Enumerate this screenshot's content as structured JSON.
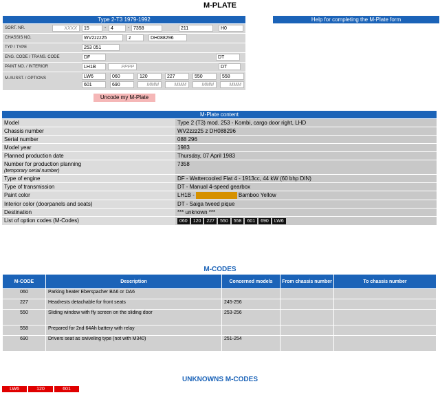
{
  "page_title": "M-PLATE",
  "form": {
    "header": "Type 2-T3 1979-1992",
    "help_header": "Help for completing the M-Plate form",
    "labels": {
      "sort_nr": "SORT. NR.",
      "chassis_no": "CHASSIS NO.",
      "typ": "TYP / TYPE",
      "eng_code": "ENG. CODE / TRANS. CODE",
      "paint_no": "PAINT NO. / INTERIOR",
      "m_ausst": "M-AUSST. / OPTIONS"
    },
    "sort_nr": {
      "placeholder": "XXXX",
      "f2": "15",
      "dash1": "-",
      "f3": "4",
      "dash2": "-",
      "f4": "7358",
      "f5": "211",
      "f6": "H0"
    },
    "chassis": {
      "f1": "WV2zzz25",
      "f2": "z",
      "f3": "DH088296"
    },
    "typ": {
      "f1": "253 051"
    },
    "eng": {
      "engine": "DF",
      "trans": "DT"
    },
    "paint": {
      "paint": "LH1B",
      "interior_placeholder": "PPPP",
      "interior": "DT"
    },
    "options_row1": [
      "LW6",
      "060",
      "120",
      "227",
      "550",
      "558"
    ],
    "options_row2": [
      "601",
      "690",
      "MMM",
      "MMM",
      "MMM",
      "MMM"
    ],
    "button": "Uncode my M-Plate"
  },
  "content": {
    "header": "M-Plate content",
    "rows": {
      "model": {
        "k": "Model",
        "v": "Type 2 (T3) mod. 253 - Kombi, cargo door right, LHD"
      },
      "chassis": {
        "k": "Chassis number",
        "v": "WV2zzz25 z DH088296"
      },
      "serial": {
        "k": "Serial number",
        "v": "088 296"
      },
      "year": {
        "k": "Model year",
        "v": "1983"
      },
      "date": {
        "k": "Planned production date",
        "v": "Thursday, 07 April 1983"
      },
      "prod": {
        "k": "Number for production planning",
        "sub": "(temporary serial number)",
        "v": "7358"
      },
      "engine": {
        "k": "Type of engine",
        "v": "DF - Wattercooled Flat 4 - 1913cc, 44 kW (60 bhp DIN)"
      },
      "trans": {
        "k": "Type of transmission",
        "v": "DT - Manual 4-speed gearbox"
      },
      "paint": {
        "k": "Paint color",
        "code": "LH1B -",
        "name": "Bamboo Yellow",
        "color": "#d69100"
      },
      "interior": {
        "k": "Interior color (doorpanels and seats)",
        "v": "DT - Saiga tweed pique"
      },
      "dest": {
        "k": "Destination",
        "v": "*** unknown ***"
      },
      "options": {
        "k": "List of option codes (M-Codes)",
        "codes": [
          "060",
          "120",
          "227",
          "550",
          "558",
          "601",
          "690",
          "LW6"
        ]
      }
    }
  },
  "mcodes": {
    "title": "M-CODES",
    "headers": [
      "M-CODE",
      "Description",
      "Concerned models",
      "From chassis number",
      "To chassis number"
    ],
    "rows": [
      {
        "code": "060",
        "desc": "Parking heater Eberspacher BA6 or DA6",
        "models": "",
        "from": "",
        "to": ""
      },
      {
        "code": "227",
        "desc": "Headrests detachable for front seats",
        "models": "245-256",
        "from": "",
        "to": ""
      },
      {
        "code": "550",
        "desc": "Sliding window with fly screen on the sliding door",
        "models": "253-256",
        "from": "",
        "to": ""
      },
      {
        "code": "558",
        "desc": "Prepared for 2nd 64Ah battery with relay",
        "models": "",
        "from": "",
        "to": ""
      },
      {
        "code": "690",
        "desc": "Drivers seat as swiveling type (not with M340)",
        "models": "251-254",
        "from": "",
        "to": ""
      }
    ]
  },
  "unknowns": {
    "title": "UNKNOWNS M-CODES",
    "codes": [
      "LW6",
      "120",
      "601"
    ]
  }
}
